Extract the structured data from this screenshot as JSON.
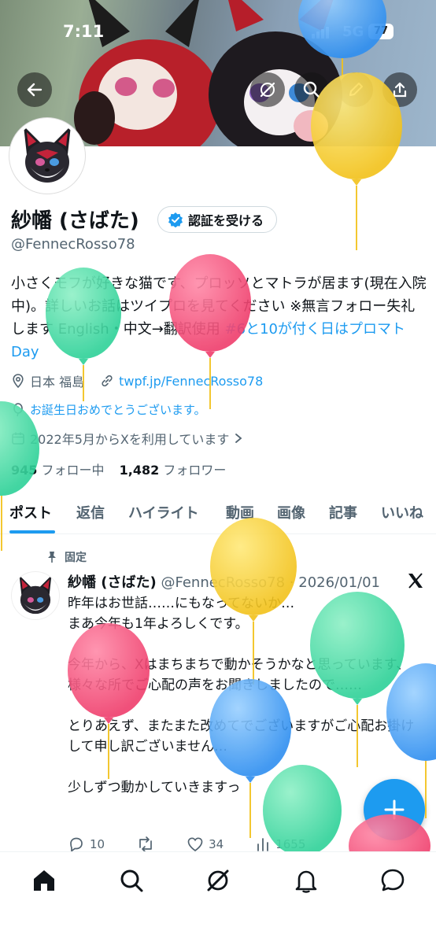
{
  "status": {
    "time": "7:11",
    "network": "5G",
    "battery": "77"
  },
  "profile": {
    "name": "紗幡 (さばた)",
    "verify_label": "認証を受ける",
    "handle": "@FennecRosso78",
    "bio_text": "小さくモフが好きな猫です、プロッソとマトラが居ます(現在入院中)。詳しいお話はツイプロを見てください ※無言フォロー失礼します English・中文→翻訳使用 ",
    "bio_link": "#6と10が付く日はプロマトDay",
    "location": "日本 福島",
    "url": "twpf.jp/FennecRosso78",
    "birthday": "お誕生日おめでとうございます。",
    "joined": "2022年5月からXを利用しています",
    "following_count": "945",
    "following_label": "フォロー中",
    "followers_count": "1,482",
    "followers_label": "フォロワー"
  },
  "tabs": [
    "ポスト",
    "返信",
    "ハイライト",
    "動画",
    "画像",
    "記事",
    "いいね"
  ],
  "post": {
    "pinned_label": "固定",
    "author": "紗幡 (さばた)",
    "meta": "@FennecRosso78 · 2026/01/01",
    "lines": [
      "昨年はお世話……にもなってないか…",
      "まあ今年も1年よろしくです。",
      "",
      "今年から、Xはまちまちで動かそうかなと思っています、様々な所でご心配の声をお聞きしましたので……",
      "",
      "とりあえず、またまた改めてでございますがご心配お掛けして申し訳ございません…",
      "",
      "少しずつ動かしていきますっ"
    ],
    "replies": "10",
    "likes": "34",
    "views": "1655"
  },
  "colors": {
    "accent": "#1d9bf0",
    "text": "#0f1419",
    "muted": "#536471"
  }
}
